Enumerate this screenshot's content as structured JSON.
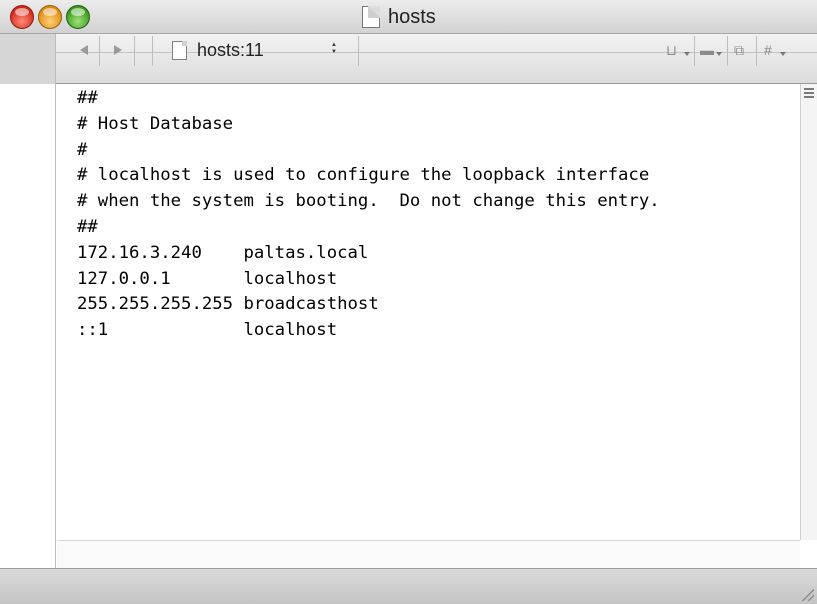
{
  "window": {
    "title": "hosts"
  },
  "navigation": {
    "file_popup_label": "hosts:11",
    "updown_glyph_up": "▲",
    "updown_glyph_down": "▼"
  },
  "toolbar_icons": [
    {
      "name": "bookmarks-icon",
      "glyph": "⊔"
    },
    {
      "name": "function-menu-icon",
      "glyph": "▬"
    },
    {
      "name": "counterpart-icon",
      "glyph": "⧉"
    },
    {
      "name": "hash-menu-icon",
      "glyph": "#"
    }
  ],
  "editor": {
    "lines": [
      "##",
      "# Host Database",
      "#",
      "# localhost is used to configure the loopback interface",
      "# when the system is booting.  Do not change this entry.",
      "##",
      "172.16.3.240    paltas.local",
      "127.0.0.1       localhost",
      "255.255.255.255 broadcasthost",
      "::1             localhost"
    ]
  },
  "colors": {
    "close": "#d2281a",
    "minimize": "#e08a10",
    "zoom": "#3a9a1a"
  }
}
